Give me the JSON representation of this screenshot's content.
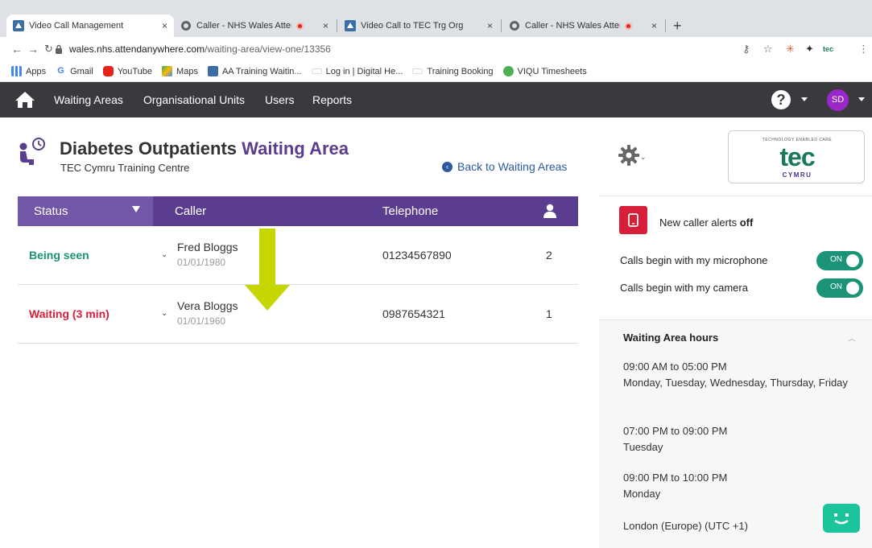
{
  "browser": {
    "tabs": [
      {
        "title": "Video Call Management",
        "close": "×",
        "recording": false
      },
      {
        "title": "Caller - NHS Wales Attend",
        "close": "×",
        "recording": true
      },
      {
        "title": "Video Call to TEC Trg Org",
        "close": "×",
        "recording": false
      },
      {
        "title": "Caller - NHS Wales Attend",
        "close": "×",
        "recording": true
      }
    ],
    "new_tab": "+",
    "url_host": "wales.nhs.attendanywhere.com",
    "url_path": "/waiting-area/view-one/13356",
    "bookmarks": [
      "Apps",
      "Gmail",
      "YouTube",
      "Maps",
      "AA Training Waitin...",
      "Log in | Digital He...",
      "Training Booking",
      "VIQU Timesheets"
    ]
  },
  "nav": {
    "items": [
      "Waiting Areas",
      "Organisational Units",
      "Users",
      "Reports"
    ],
    "help": "?",
    "avatar": "SD"
  },
  "page": {
    "title_main": "Diabetes Outpatients",
    "title_accent": "Waiting Area",
    "subtitle": "TEC Cymru Training Centre",
    "back_link": "Back to Waiting Areas"
  },
  "table": {
    "headers": {
      "status": "Status",
      "caller": "Caller",
      "telephone": "Telephone"
    },
    "rows": [
      {
        "status": "Being seen",
        "status_color": "#1a9377",
        "name": "Fred Bloggs",
        "dob": "01/01/1980",
        "telephone": "01234567890",
        "count": "2"
      },
      {
        "status": "Waiting (3 min)",
        "status_color": "#d81f3a",
        "name": "Vera Bloggs",
        "dob": "01/01/1960",
        "telephone": "0987654321",
        "count": "1"
      }
    ]
  },
  "side": {
    "logo": {
      "small": "TECHNOLOGY ENABLED CARE",
      "big": "tec",
      "sub": "CYMRU"
    },
    "alerts": {
      "prefix": "New caller alerts ",
      "state": "off"
    },
    "options": [
      {
        "label": "Calls begin with my microphone",
        "toggle": "ON"
      },
      {
        "label": "Calls begin with my camera",
        "toggle": "ON"
      }
    ],
    "hours_title": "Waiting Area hours",
    "hours": [
      {
        "time": "09:00 AM to 05:00 PM",
        "days": "Monday, Tuesday, Wednesday, Thursday, Friday"
      },
      {
        "time": "07:00 PM to 09:00 PM",
        "days": "Tuesday"
      },
      {
        "time": "09:00 PM to 10:00 PM",
        "days": "Monday"
      }
    ],
    "timezone": "London (Europe) (UTC +1)"
  },
  "colors": {
    "nav_bg": "#3a3a3e",
    "table_header": "#5a3d8f",
    "status_header": "#7257a6",
    "being_seen": "#1a9377",
    "waiting": "#d81f3a",
    "toggle_on": "#1a9377",
    "arrow": "#c6d600",
    "chat_bubble": "#1bc49a"
  }
}
